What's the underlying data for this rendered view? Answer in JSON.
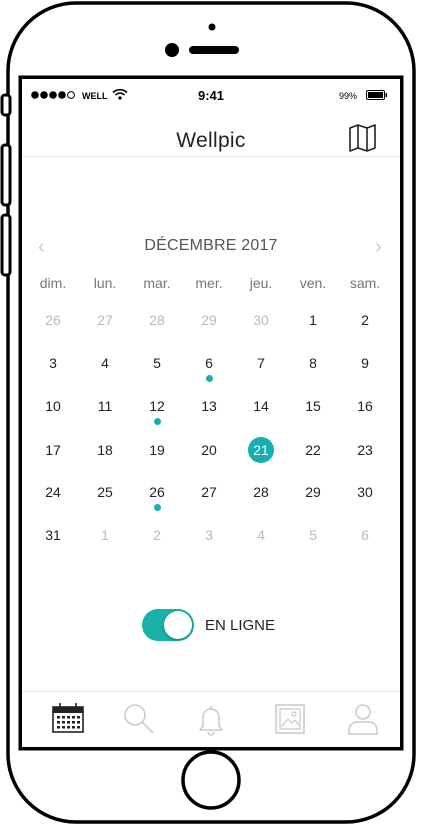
{
  "status_bar": {
    "carrier": "WELL",
    "time": "9:41",
    "battery": "99%"
  },
  "nav": {
    "title": "Wellpic",
    "map_icon": "map-icon"
  },
  "calendar": {
    "month_label": "DÉCEMBRE 2017",
    "prev_icon": "chevron-left-icon",
    "next_icon": "chevron-right-icon",
    "weekdays": [
      "dim.",
      "lun.",
      "mar.",
      "mer.",
      "jeu.",
      "ven.",
      "sam."
    ],
    "weeks": [
      [
        "26",
        "27",
        "28",
        "29",
        "30",
        "1",
        "2"
      ],
      [
        "3",
        "4",
        "5",
        "6",
        "7",
        "8",
        "9"
      ],
      [
        "10",
        "11",
        "12",
        "13",
        "14",
        "15",
        "16"
      ],
      [
        "17",
        "18",
        "19",
        "20",
        "21",
        "22",
        "23"
      ],
      [
        "24",
        "25",
        "26",
        "27",
        "28",
        "29",
        "30"
      ],
      [
        "31",
        "1",
        "2",
        "3",
        "4",
        "5",
        "6"
      ]
    ],
    "outside_month": [
      [
        0,
        0
      ],
      [
        0,
        1
      ],
      [
        0,
        2
      ],
      [
        0,
        3
      ],
      [
        0,
        4
      ],
      [
        5,
        1
      ],
      [
        5,
        2
      ],
      [
        5,
        3
      ],
      [
        5,
        4
      ],
      [
        5,
        5
      ],
      [
        5,
        6
      ]
    ],
    "event_dots": [
      "6",
      "12",
      "26"
    ],
    "selected": "21",
    "accent_color": "#16aeb0"
  },
  "online_toggle": {
    "label": "EN LIGNE",
    "on": true
  },
  "tabbar": {
    "items": [
      {
        "icon": "calendar-icon",
        "active": true
      },
      {
        "icon": "search-icon",
        "active": false
      },
      {
        "icon": "bell-icon",
        "active": false
      },
      {
        "icon": "photo-icon",
        "active": false
      },
      {
        "icon": "profile-icon",
        "active": false
      }
    ]
  }
}
